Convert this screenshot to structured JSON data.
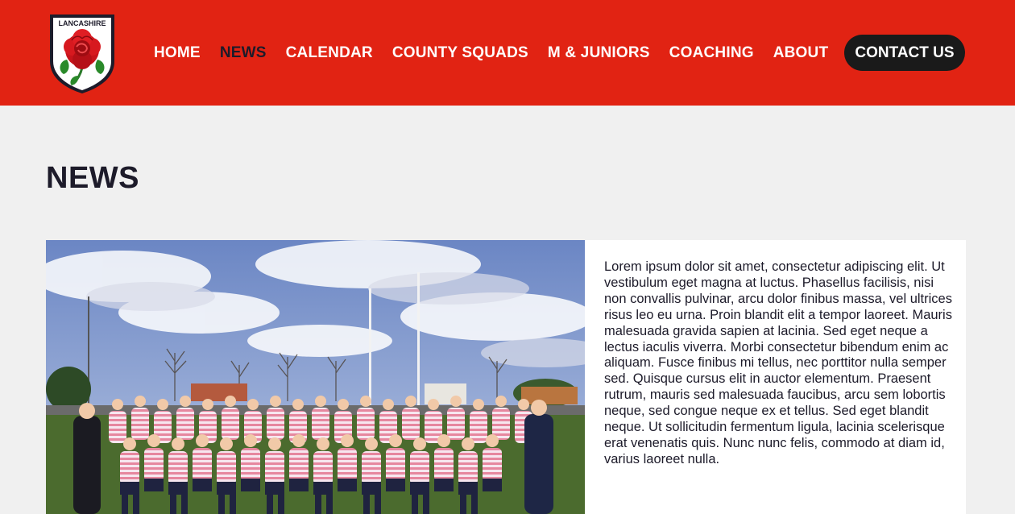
{
  "brand": {
    "logo_text": "LANCASHIRE",
    "colors": {
      "header_red": "#e12313",
      "nav_active": "#1d1b2a",
      "button_dark": "#1a1a1a",
      "page_bg": "#f0f0f0"
    }
  },
  "nav": {
    "items": [
      {
        "label": "HOME",
        "active": false
      },
      {
        "label": "NEWS",
        "active": true
      },
      {
        "label": "CALENDAR",
        "active": false
      },
      {
        "label": "COUNTY SQUADS",
        "active": false
      },
      {
        "label": "M & JUNIORS",
        "active": false
      },
      {
        "label": "COACHING",
        "active": false
      },
      {
        "label": "ABOUT",
        "active": false
      }
    ],
    "contact_label": "CONTACT US"
  },
  "page": {
    "title": "NEWS"
  },
  "article": {
    "image_icon": "team-photo",
    "body": "Lorem ipsum dolor sit amet, consectetur adipiscing elit. Ut vestibulum eget magna at luctus. Phasellus facilisis, nisi non convallis pulvinar, arcu dolor finibus massa, vel ultrices risus leo eu urna. Proin blandit elit a tempor laoreet. Mauris malesuada gravida sapien at lacinia. Sed eget neque a lectus iaculis viverra. Morbi consectetur bibendum enim ac aliquam. Fusce finibus mi tellus, nec porttitor nulla semper sed. Quisque cursus elit in auctor elementum. Praesent rutrum, mauris sed malesuada faucibus, arcu sem lobortis neque, sed congue neque ex et tellus. Sed eget blandit neque. Ut sollicitudin fermentum ligula, lacinia scelerisque erat venenatis quis. Nunc nunc felis, commodo at diam id, varius laoreet nulla."
  }
}
